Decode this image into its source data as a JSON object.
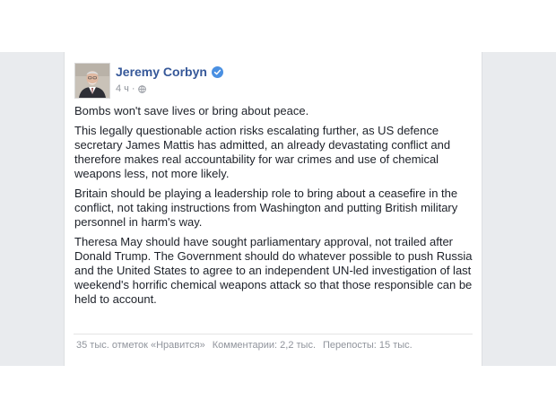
{
  "post": {
    "author": "Jeremy Corbyn",
    "time": "4 ч",
    "separator": "·",
    "paragraphs": [
      "Bombs won't save lives or bring about peace.",
      "This legally questionable action risks escalating further, as US defence secretary James Mattis has admitted, an already devastating conflict and therefore makes real accountability for war crimes and use of chemical weapons less, not more likely.",
      "Britain should be playing a leadership role to bring about a ceasefire in the conflict, not taking instructions from Washington and putting British military personnel in harm's way.",
      "Theresa May should have sought parliamentary approval, not trailed after Donald Trump. The Government should do whatever possible to push Russia and the United States to agree to an independent UN-led investigation of last weekend's horrific chemical weapons attack so that those responsible can be held to account."
    ]
  },
  "stats": {
    "likes": "35 тыс. отметок «Нравится»",
    "comments": "Комментарии: 2,2 тыс.",
    "shares": "Перепосты: 15 тыс."
  },
  "icons": {
    "verified": "verified-badge-icon",
    "audience": "globe-icon"
  },
  "colors": {
    "author_link": "#365899",
    "verified": "#4a90e2",
    "background": "#e9ebee",
    "text": "#1d2129",
    "meta": "#90949c"
  }
}
